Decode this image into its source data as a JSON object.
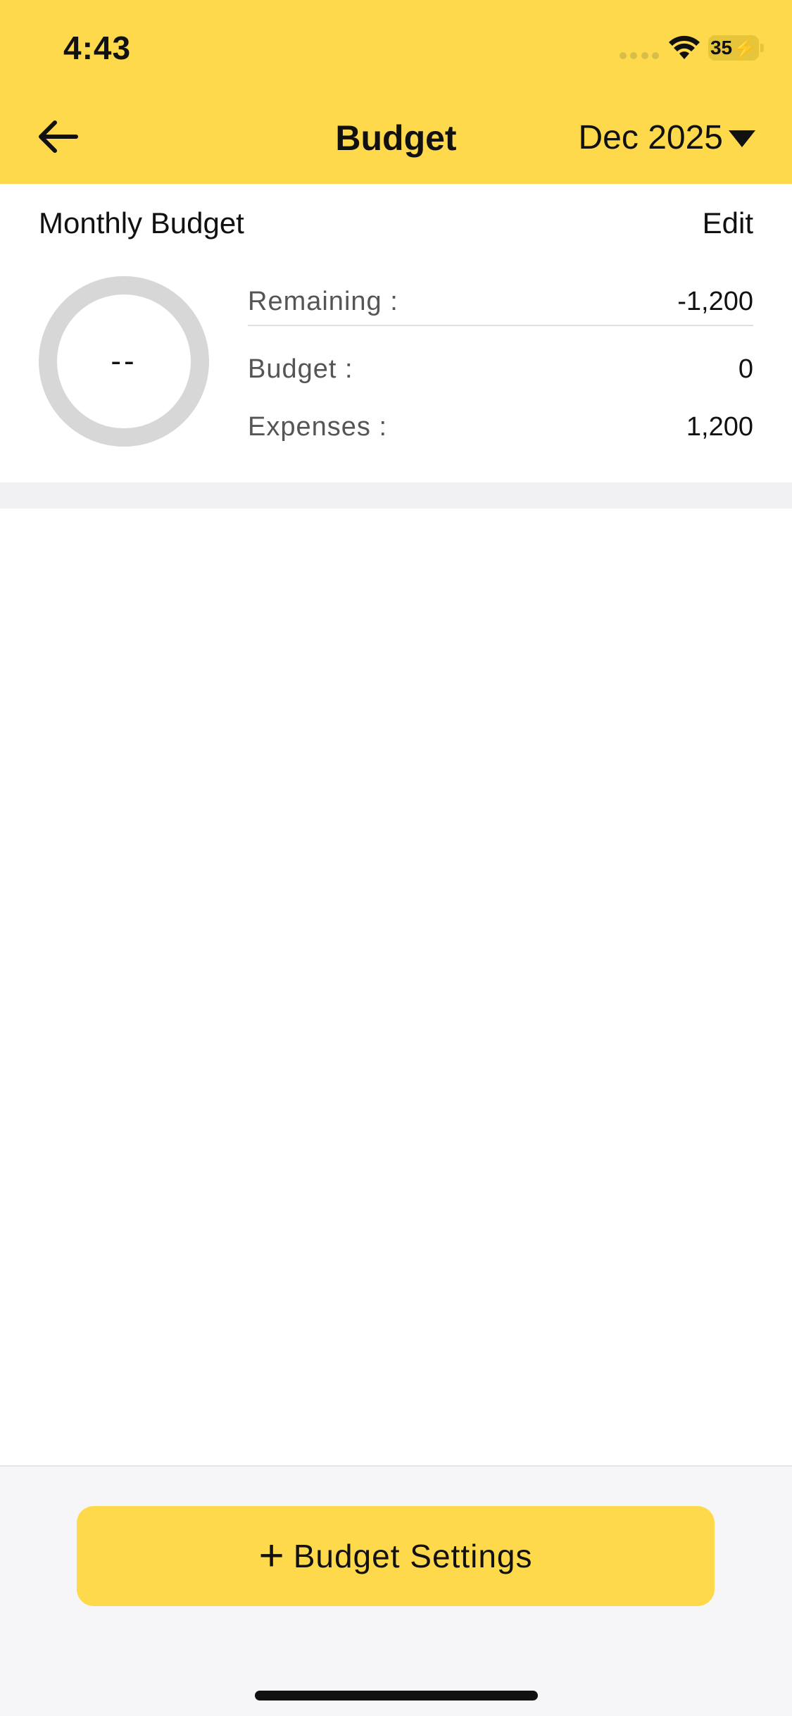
{
  "colors": {
    "accent": "#FED94C",
    "ring": "#d7d7d7",
    "band": "#f1f1f4"
  },
  "status_bar": {
    "time": "4:43",
    "battery": "35"
  },
  "nav": {
    "title": "Budget",
    "month": "Dec 2025"
  },
  "monthly_budget": {
    "title": "Monthly Budget",
    "edit_label": "Edit",
    "ring_text": "--",
    "remaining_label": "Remaining :",
    "remaining_value": "-1,200",
    "budget_label": "Budget :",
    "budget_value": "0",
    "expenses_label": "Expenses :",
    "expenses_value": "1,200"
  },
  "footer": {
    "settings_button": "Budget Settings",
    "plus": "+"
  }
}
